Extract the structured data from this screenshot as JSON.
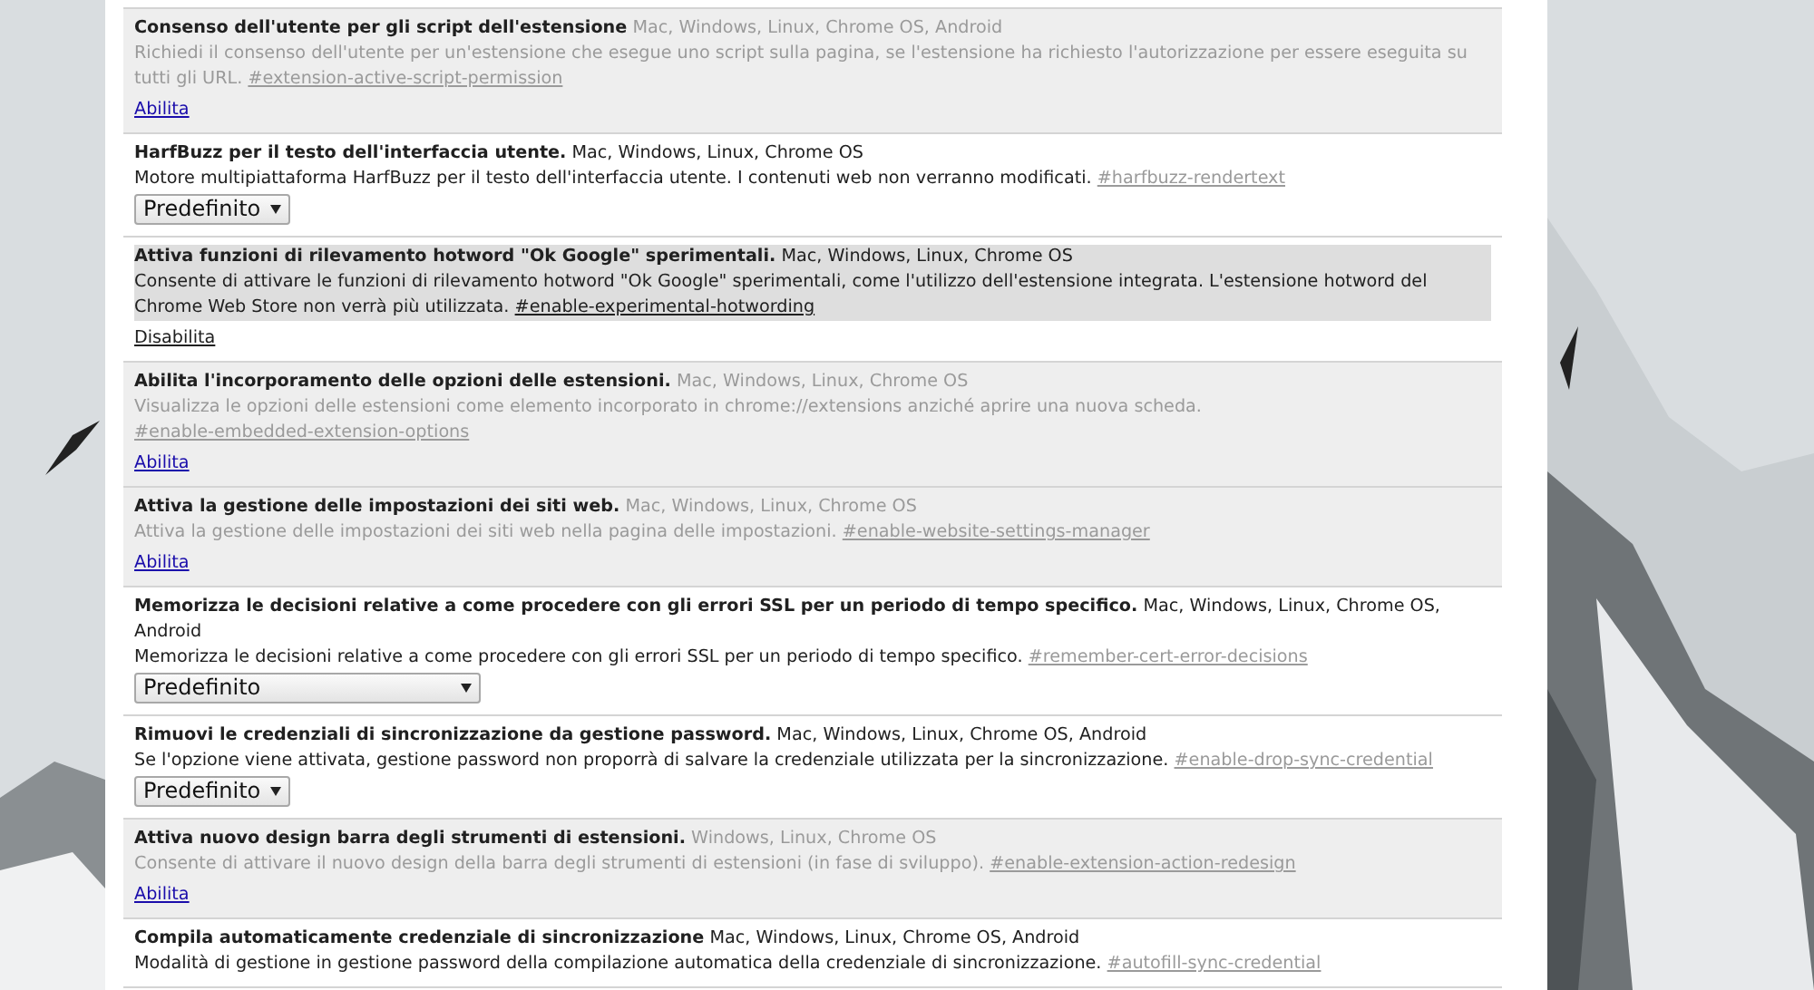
{
  "experiments": [
    {
      "title": "Consenso dell'utente per gli script dell'estensione",
      "platforms": "Mac, Windows, Linux, Chrome OS, Android",
      "description": "Richiedi il consenso dell'utente per un'estensione che esegue uno script sulla pagina, se l'estensione ha richiesto l'autorizzazione per essere eseguita su tutti gli URL.",
      "anchor": "#extension-active-script-permission",
      "enabled": false,
      "highlighted": false,
      "control": {
        "kind": "link",
        "label": "Abilita"
      }
    },
    {
      "title": "HarfBuzz per il testo dell'interfaccia utente.",
      "platforms": "Mac, Windows, Linux, Chrome OS",
      "description": "Motore multipiattaforma HarfBuzz per il testo dell'interfaccia utente. I contenuti web non verranno modificati.",
      "anchor": "#harfbuzz-rendertext",
      "enabled": true,
      "highlighted": false,
      "control": {
        "kind": "select",
        "label": "Predefinito",
        "wide": false
      }
    },
    {
      "title": "Attiva funzioni di rilevamento hotword \"Ok Google\" sperimentali.",
      "platforms": "Mac, Windows, Linux, Chrome OS",
      "description": "Consente di attivare le funzioni di rilevamento hotword \"Ok Google\" sperimentali, come l'utilizzo dell'estensione integrata. L'estensione hotword del Chrome Web Store non verrà più utilizzata.",
      "anchor": "#enable-experimental-hotwording",
      "enabled": true,
      "highlighted": true,
      "control": {
        "kind": "link",
        "label": "Disabilita"
      }
    },
    {
      "title": "Abilita l'incorporamento delle opzioni delle estensioni.",
      "platforms": "Mac, Windows, Linux, Chrome OS",
      "description": "Visualizza le opzioni delle estensioni come elemento incorporato in chrome://extensions anziché aprire una nuova scheda.",
      "anchor": "#enable-embedded-extension-options",
      "enabled": false,
      "highlighted": false,
      "control": {
        "kind": "link",
        "label": "Abilita"
      }
    },
    {
      "title": "Attiva la gestione delle impostazioni dei siti web.",
      "platforms": "Mac, Windows, Linux, Chrome OS",
      "description": "Attiva la gestione delle impostazioni dei siti web nella pagina delle impostazioni.",
      "anchor": "#enable-website-settings-manager",
      "enabled": false,
      "highlighted": false,
      "control": {
        "kind": "link",
        "label": "Abilita"
      }
    },
    {
      "title": "Memorizza le decisioni relative a come procedere con gli errori SSL per un periodo di tempo specifico.",
      "platforms": "Mac, Windows, Linux, Chrome OS, Android",
      "description": "Memorizza le decisioni relative a come procedere con gli errori SSL per un periodo di tempo specifico.",
      "anchor": "#remember-cert-error-decisions",
      "enabled": true,
      "highlighted": false,
      "control": {
        "kind": "select",
        "label": "Predefinito",
        "wide": true
      }
    },
    {
      "title": "Rimuovi le credenziali di sincronizzazione da gestione password.",
      "platforms": "Mac, Windows, Linux, Chrome OS, Android",
      "description": "Se l'opzione viene attivata, gestione password non proporrà di salvare la credenziale utilizzata per la sincronizzazione.",
      "anchor": "#enable-drop-sync-credential",
      "enabled": true,
      "highlighted": false,
      "control": {
        "kind": "select",
        "label": "Predefinito",
        "wide": false
      }
    },
    {
      "title": "Attiva nuovo design barra degli strumenti di estensioni.",
      "platforms": "Windows, Linux, Chrome OS",
      "description": "Consente di attivare il nuovo design della barra degli strumenti di estensioni (in fase di sviluppo).",
      "anchor": "#enable-extension-action-redesign",
      "enabled": false,
      "highlighted": false,
      "control": {
        "kind": "link",
        "label": "Abilita"
      }
    },
    {
      "title": "Compila automaticamente credenziale di sincronizzazione",
      "platforms": "Mac, Windows, Linux, Chrome OS, Android",
      "description": "Modalità di gestione in gestione password della compilazione automatica della credenziale di sincronizzazione.",
      "anchor": "#autofill-sync-credential",
      "enabled": true,
      "highlighted": false
    }
  ]
}
